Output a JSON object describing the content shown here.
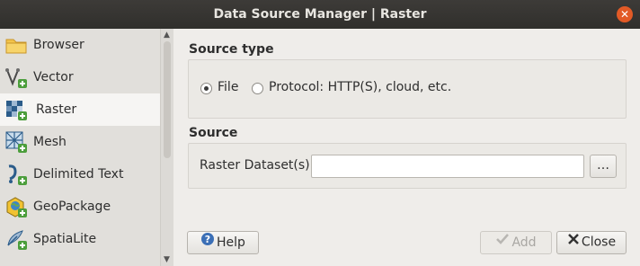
{
  "window": {
    "title": "Data Source Manager | Raster"
  },
  "sidebar": {
    "items": [
      {
        "label": "Browser",
        "icon": "folder-icon"
      },
      {
        "label": "Vector",
        "icon": "vector-icon"
      },
      {
        "label": "Raster",
        "icon": "raster-icon",
        "selected": true
      },
      {
        "label": "Mesh",
        "icon": "mesh-icon"
      },
      {
        "label": "Delimited Text",
        "icon": "delimited-text-icon"
      },
      {
        "label": "GeoPackage",
        "icon": "geopackage-icon"
      },
      {
        "label": "SpatiaLite",
        "icon": "spatialite-icon"
      }
    ]
  },
  "source_type": {
    "heading": "Source type",
    "options": [
      {
        "label": "File",
        "checked": true
      },
      {
        "label": "Protocol: HTTP(S), cloud, etc.",
        "checked": false
      }
    ]
  },
  "source": {
    "heading": "Source",
    "dataset_label": "Raster Dataset(s)",
    "dataset_value": "",
    "browse_label": "…"
  },
  "buttons": {
    "help": "Help",
    "add": "Add",
    "close": "Close"
  },
  "colors": {
    "titlebar": "#302f2c",
    "close_button": "#e25a26",
    "add_icon": "#4c9e3c",
    "help_icon": "#3b6fb6"
  }
}
